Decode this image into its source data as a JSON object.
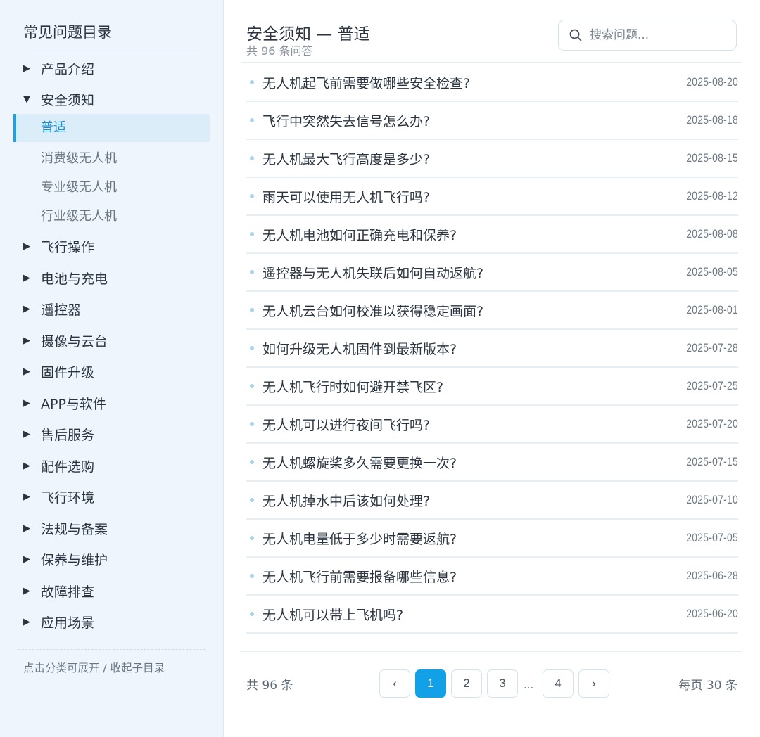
{
  "sidebar": {
    "title": "常见问题目录",
    "categories": [
      {
        "label": "产品介绍",
        "icon": "triangle-right-icon"
      },
      {
        "label": "安全须知",
        "icon": "triangle-down-icon"
      },
      {
        "label": "飞行操作",
        "icon": "triangle-right-icon"
      },
      {
        "label": "电池与充电",
        "icon": "triangle-right-icon"
      },
      {
        "label": "遥控器",
        "icon": "triangle-right-icon"
      },
      {
        "label": "摄像与云台",
        "icon": "triangle-right-icon"
      },
      {
        "label": "固件升级",
        "icon": "triangle-right-icon"
      },
      {
        "label": "APP与软件",
        "icon": "triangle-right-icon"
      },
      {
        "label": "售后服务",
        "icon": "triangle-right-icon"
      },
      {
        "label": "配件选购",
        "icon": "triangle-right-icon"
      },
      {
        "label": "飞行环境",
        "icon": "triangle-right-icon"
      },
      {
        "label": "法规与备案",
        "icon": "triangle-right-icon"
      },
      {
        "label": "保养与维护",
        "icon": "triangle-right-icon"
      },
      {
        "label": "故障排查",
        "icon": "triangle-right-icon"
      },
      {
        "label": "应用场景",
        "icon": "triangle-right-icon"
      }
    ],
    "subcategories": [
      "普适",
      "消费级无人机",
      "专业级无人机",
      "行业级无人机"
    ],
    "active_sub": "普适",
    "hint": "点击分类可展开 / 收起子目录"
  },
  "header": {
    "title": "安全须知 — 普适",
    "count": "共 96 条问答"
  },
  "search": {
    "placeholder": "搜索问题...",
    "icon": "search-icon"
  },
  "questions": [
    {
      "text": "无人机起飞前需要做哪些安全检查?",
      "date": "2025-08-20"
    },
    {
      "text": "飞行中突然失去信号怎么办?",
      "date": "2025-08-18"
    },
    {
      "text": "无人机最大飞行高度是多少?",
      "date": "2025-08-15"
    },
    {
      "text": "雨天可以使用无人机飞行吗?",
      "date": "2025-08-12"
    },
    {
      "text": "无人机电池如何正确充电和保养?",
      "date": "2025-08-08"
    },
    {
      "text": "遥控器与无人机失联后如何自动返航?",
      "date": "2025-08-05"
    },
    {
      "text": "无人机云台如何校准以获得稳定画面?",
      "date": "2025-08-01"
    },
    {
      "text": "如何升级无人机固件到最新版本?",
      "date": "2025-07-28"
    },
    {
      "text": "无人机飞行时如何避开禁飞区?",
      "date": "2025-07-25"
    },
    {
      "text": "无人机可以进行夜间飞行吗?",
      "date": "2025-07-20"
    },
    {
      "text": "无人机螺旋桨多久需要更换一次?",
      "date": "2025-07-15"
    },
    {
      "text": "无人机掉水中后该如何处理?",
      "date": "2025-07-10"
    },
    {
      "text": "无人机电量低于多少时需要返航?",
      "date": "2025-07-05"
    },
    {
      "text": "无人机飞行前需要报备哪些信息?",
      "date": "2025-06-28"
    },
    {
      "text": "无人机可以带上飞机吗?",
      "date": "2025-06-20"
    }
  ],
  "pagination": {
    "total": "共 96 条",
    "prev": "‹",
    "next": "›",
    "pages": [
      "1",
      "2",
      "3",
      "4"
    ],
    "ellipsis": "...",
    "current": "1",
    "per_page": "每页 30 条"
  },
  "colors": {
    "accent": "#12a0e6",
    "sidebar_bg": "#eef5fc",
    "active_bg": "#dcedfa"
  }
}
